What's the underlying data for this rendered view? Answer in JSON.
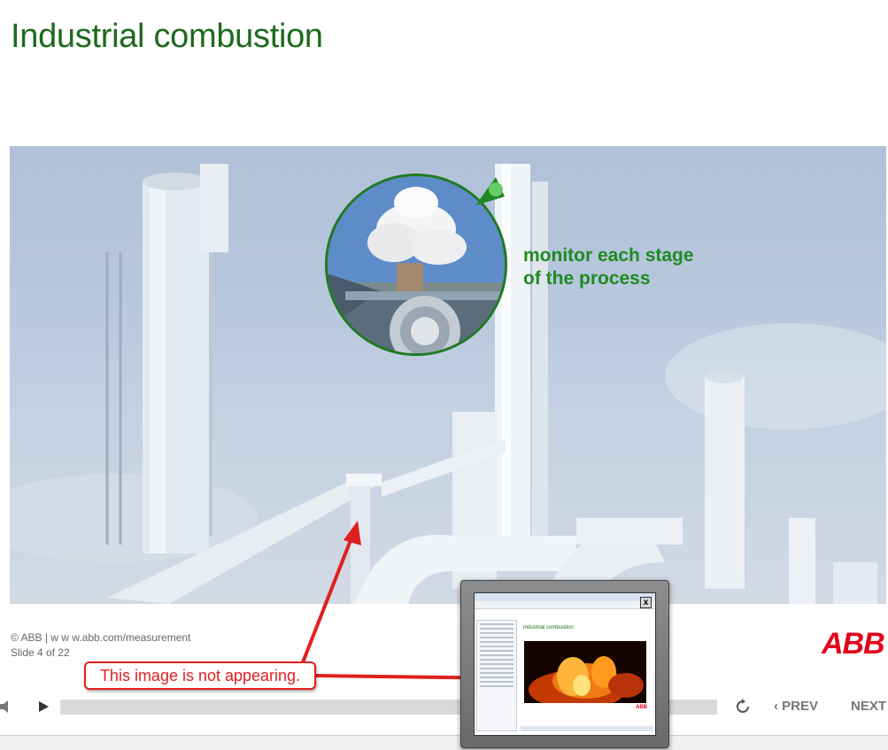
{
  "slide": {
    "title": "Industrial combustion",
    "callout_line1": "monitor each stage",
    "callout_line2": "of the process",
    "copyright": "© ABB | w w w.abb.com/measurement",
    "slide_number": "Slide 4 of 22",
    "logo_text": "ABB"
  },
  "player": {
    "prev_label": "PREV",
    "next_label": "NEXT",
    "prev_glyph": "‹",
    "icons": [
      "volume-icon",
      "play-icon",
      "replay-icon"
    ]
  },
  "annotation": {
    "text": "This image is not appearing.",
    "color": "#e02020"
  },
  "thumbnail": {
    "title": "Industrial combustion",
    "logo_text": "ABB",
    "close_glyph": "x"
  },
  "colors": {
    "title_green": "#1e6a1e",
    "callout_green": "#1f8a22",
    "abb_red": "#e2001a"
  }
}
